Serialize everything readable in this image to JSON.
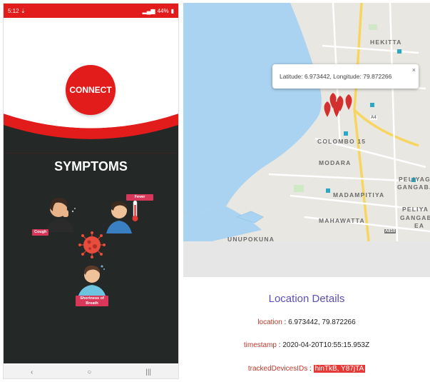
{
  "status_bar": {
    "time": "5:12",
    "icons_left": "⇣",
    "battery": "44%"
  },
  "connect_button": {
    "label": "CONNECT"
  },
  "symptoms": {
    "title": "SYMPTOMS",
    "items": [
      {
        "label": "Cough"
      },
      {
        "label": "Fever"
      },
      {
        "label": "Shortness of\nBreath"
      }
    ]
  },
  "nav": {
    "back": "‹",
    "home": "○",
    "recents": "|||"
  },
  "map": {
    "labels": [
      "HEKITTA",
      "COLOMBO 15",
      "MODARA",
      "PELIYAGO",
      "GANGABA",
      "MADAMPITIYA",
      "PELIYA",
      "GANGABA",
      "EA",
      "MAHAWATTA",
      "A4",
      "A810",
      "UNUPOKUNA"
    ],
    "popup_text": "Latitude: 6.973442, Longitude: 79.872266",
    "popup_close": "×"
  },
  "details": {
    "title": "Location Details",
    "location_key": "location",
    "location_value": "6.973442, 79.872266",
    "timestamp_key": "timestamp",
    "timestamp_value": "2020-04-20T10:55:15.953Z",
    "tracked_key": "trackedDevicesIDs",
    "tracked_value": "hinTkB, Y87jTA"
  },
  "colors": {
    "accent": "#e21b1b",
    "dark_panel": "#242827",
    "water": "#aad3f2",
    "title": "#5b4fb8"
  }
}
